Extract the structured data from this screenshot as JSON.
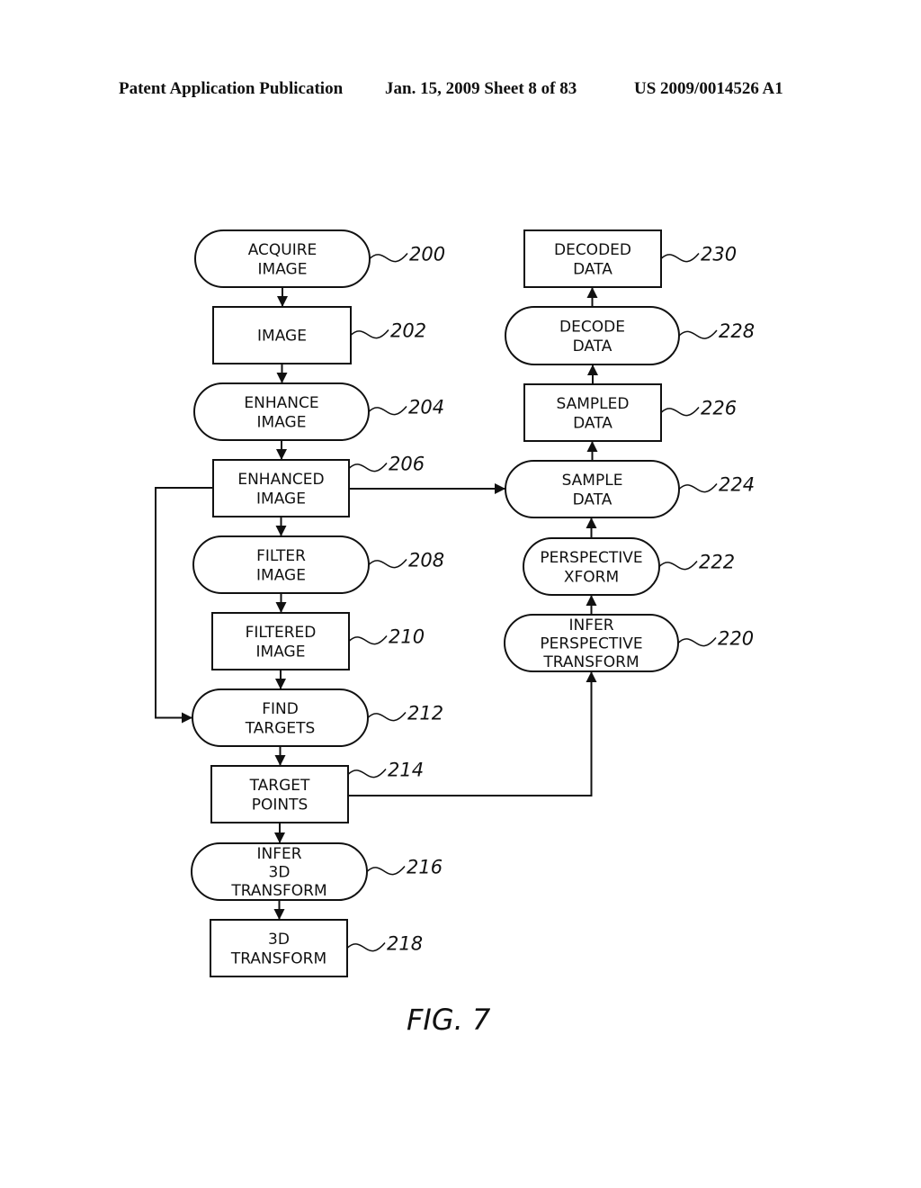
{
  "header": {
    "publication": "Patent Application Publication",
    "date_sheet": "Jan. 15, 2009  Sheet 8 of 83",
    "number": "US 2009/0014526 A1"
  },
  "figure_label": "FIG. 7",
  "nodes": [
    {
      "id": "200",
      "shape": "rounded",
      "lines": [
        "ACQUIRE",
        "IMAGE"
      ]
    },
    {
      "id": "202",
      "shape": "rect",
      "lines": [
        "IMAGE"
      ]
    },
    {
      "id": "204",
      "shape": "rounded",
      "lines": [
        "ENHANCE",
        "IMAGE"
      ]
    },
    {
      "id": "206",
      "shape": "rect",
      "lines": [
        "ENHANCED",
        "IMAGE"
      ]
    },
    {
      "id": "208",
      "shape": "rounded",
      "lines": [
        "FILTER",
        "IMAGE"
      ]
    },
    {
      "id": "210",
      "shape": "rect",
      "lines": [
        "FILTERED",
        "IMAGE"
      ]
    },
    {
      "id": "212",
      "shape": "rounded",
      "lines": [
        "FIND",
        "TARGETS"
      ]
    },
    {
      "id": "214",
      "shape": "rect",
      "lines": [
        "TARGET",
        "POINTS"
      ]
    },
    {
      "id": "216",
      "shape": "rounded",
      "lines": [
        "INFER",
        "3D",
        "TRANSFORM"
      ]
    },
    {
      "id": "218",
      "shape": "rect",
      "lines": [
        "3D",
        "TRANSFORM"
      ]
    },
    {
      "id": "220",
      "shape": "rounded",
      "lines": [
        "INFER",
        "PERSPECTIVE",
        "TRANSFORM"
      ]
    },
    {
      "id": "222",
      "shape": "rounded",
      "lines": [
        "PERSPECTIVE",
        "XFORM"
      ]
    },
    {
      "id": "224",
      "shape": "rounded",
      "lines": [
        "SAMPLE",
        "DATA"
      ]
    },
    {
      "id": "226",
      "shape": "rect",
      "lines": [
        "SAMPLED",
        "DATA"
      ]
    },
    {
      "id": "228",
      "shape": "rounded",
      "lines": [
        "DECODE",
        "DATA"
      ]
    },
    {
      "id": "230",
      "shape": "rect",
      "lines": [
        "DECODED",
        "DATA"
      ]
    }
  ],
  "edges": [
    {
      "from": "200",
      "to": "202"
    },
    {
      "from": "202",
      "to": "204"
    },
    {
      "from": "204",
      "to": "206"
    },
    {
      "from": "206",
      "to": "208"
    },
    {
      "from": "208",
      "to": "210"
    },
    {
      "from": "210",
      "to": "212"
    },
    {
      "from": "212",
      "to": "214"
    },
    {
      "from": "214",
      "to": "216"
    },
    {
      "from": "216",
      "to": "218"
    },
    {
      "from": "206",
      "to": "212",
      "route": "left-loop"
    },
    {
      "from": "206",
      "to": "224",
      "route": "horizontal"
    },
    {
      "from": "214",
      "to": "220",
      "route": "right-up"
    },
    {
      "from": "220",
      "to": "222"
    },
    {
      "from": "222",
      "to": "224"
    },
    {
      "from": "224",
      "to": "226"
    },
    {
      "from": "226",
      "to": "228"
    },
    {
      "from": "228",
      "to": "230"
    }
  ]
}
